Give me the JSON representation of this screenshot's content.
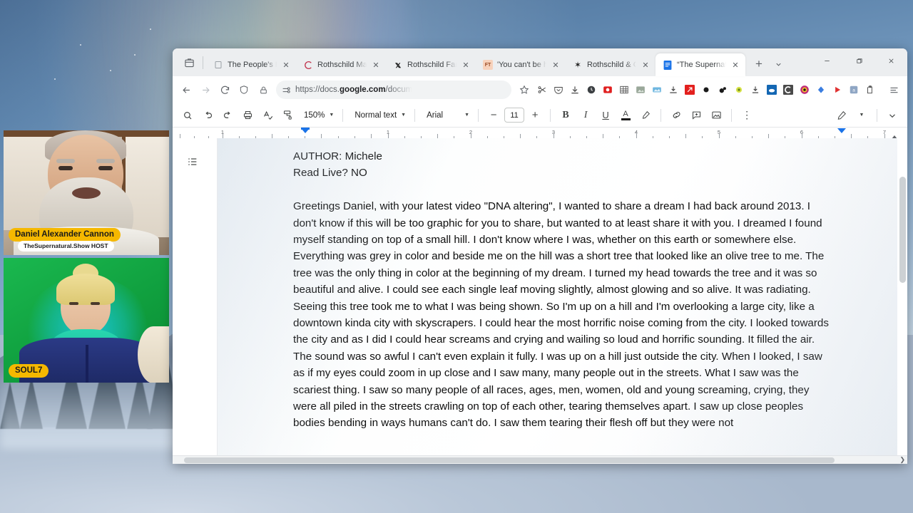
{
  "window": {
    "controls": {
      "minimize": "—",
      "maximize": "❐",
      "close": "✕"
    },
    "tab_search_icon": "tab-search-icon",
    "new_tab_label": "+",
    "tab_list_label": "⌄"
  },
  "tabs": [
    {
      "title": "The People's Bread F",
      "favicon": "generic-page-icon",
      "favicon_char": "",
      "active": false
    },
    {
      "title": "Rothschild Masterpi",
      "favicon": "christies-icon",
      "favicon_char": "C",
      "active": false
    },
    {
      "title": "Rothschild Family A",
      "favicon": "nytimes-icon",
      "favicon_char": "T",
      "active": false
    },
    {
      "title": "'You can't be half pr",
      "favicon": "financial-times-icon",
      "favicon_char": "FT",
      "active": false
    },
    {
      "title": "Rothschild & Co cor",
      "favicon": "rothschild-icon",
      "favicon_char": "✻",
      "active": false
    },
    {
      "title": "“The Supernatural S",
      "favicon": "google-docs-icon",
      "favicon_char": "≡",
      "active": true
    }
  ],
  "navbar": {
    "back_icon": "back-arrow-icon",
    "forward_icon": "forward-arrow-icon",
    "reload_icon": "reload-icon",
    "shield_icon": "shield-icon",
    "lock_icon": "lock-icon",
    "permissions_icon": "page-settings-icon",
    "url_prefix": "https://docs.",
    "url_domain": "google.com",
    "url_suffix": "/docum",
    "bookmark_icon": "star-icon",
    "extensions": [
      "scissors-extension-icon",
      "pocket-extension-icon",
      "download-extension-icon",
      "clock-extension-icon",
      "screenshot-extension-icon",
      "grid-extension-icon",
      "image-extension-icon",
      "photo-extension-icon",
      "save-extension-icon",
      "red-arrow-extension-icon",
      "black-dot-extension-icon",
      "bubbles-extension-icon",
      "yellow-circle-extension-icon",
      "download-arrow-extension-icon",
      "blue-cloud-extension-icon",
      "c-extension-icon",
      "camera-extension-icon",
      "diamond-extension-icon",
      "play-extension-icon",
      "translate-extension-icon",
      "clipboard-extension-icon"
    ],
    "menu_icon": "browser-menu-icon"
  },
  "docs_toolbar": {
    "search_icon": "search-icon",
    "undo_icon": "undo-icon",
    "redo_icon": "redo-icon",
    "print_icon": "print-icon",
    "spellcheck_icon": "spellcheck-icon",
    "paint_format_icon": "paint-format-icon",
    "zoom_value": "150%",
    "style_value": "Normal text",
    "font_value": "Arial",
    "font_decrease": "−",
    "font_size_value": "11",
    "font_increase": "+",
    "bold": "B",
    "italic": "I",
    "underline": "U",
    "text_color": "A",
    "highlight_icon": "highlight-pen-icon",
    "link_icon": "insert-link-icon",
    "comment_icon": "add-comment-icon",
    "image_icon": "insert-image-icon",
    "more_icon": "more-options-icon",
    "editing_mode_icon": "edit-pencil-icon",
    "collapse_icon": "collapse-toolbar-icon"
  },
  "ruler": {
    "numbers": [
      "1",
      "1",
      "2",
      "3",
      "4",
      "5",
      "6",
      "7"
    ],
    "indent_marker": "left-indent-marker",
    "right_indent_marker": "right-indent-marker"
  },
  "document": {
    "outline_icon": "document-outline-icon",
    "lines": [
      "AUTHOR:  Michele",
      "Read Live?  NO",
      "",
      "Greetings Daniel, with your latest video \"DNA altering\", I wanted to share a dream I had back around 2013. I don't know if this will be too graphic for you to share, but wanted to at least share it with you. I dreamed I found myself standing on top of a small hill. I don't know where I was, whether on this earth or somewhere else. Everything was grey in color and beside me on the hill was a short tree that looked like an olive tree to me. The tree was the only thing in color at the beginning of my dream. I turned my head towards the tree and it was so beautiful and alive. I could see each single leaf moving slightly, almost glowing and so alive. It was radiating. Seeing this tree took me to what I was being shown. So I'm up on a hill and I'm overlooking a large city, like a downtown kinda city with skyscrapers. I could hear the most horrific noise coming from the city. I looked towards the city and as I did I could hear screams and crying and wailing so loud and horrific sounding. It filled the air. The sound was so awful I can't even explain it fully. I was up on a hill just outside the city. When I looked, I saw as if my eyes could zoom in up close and I saw many, many people out in the streets. What I saw was the scariest thing. I saw so many people of all races, ages, men, women, old and young screaming, crying, they were all piled in the streets crawling on top of each other, tearing themselves apart. I saw up close peoples bodies bending in ways humans can't do. I saw them tearing their flesh off but they were not"
    ]
  },
  "webcams": [
    {
      "name": "Daniel Alexander Cannon",
      "subtitle": "TheSupernatural.Show HOST",
      "has_subtitle": true
    },
    {
      "name": "SOUL7",
      "subtitle": "",
      "has_subtitle": false
    }
  ],
  "colors": {
    "tag_yellow": "#f5b800",
    "docs_blue": "#1a73e8",
    "chrome_gray": "#eceef0",
    "green_screen": "#13ab44"
  }
}
